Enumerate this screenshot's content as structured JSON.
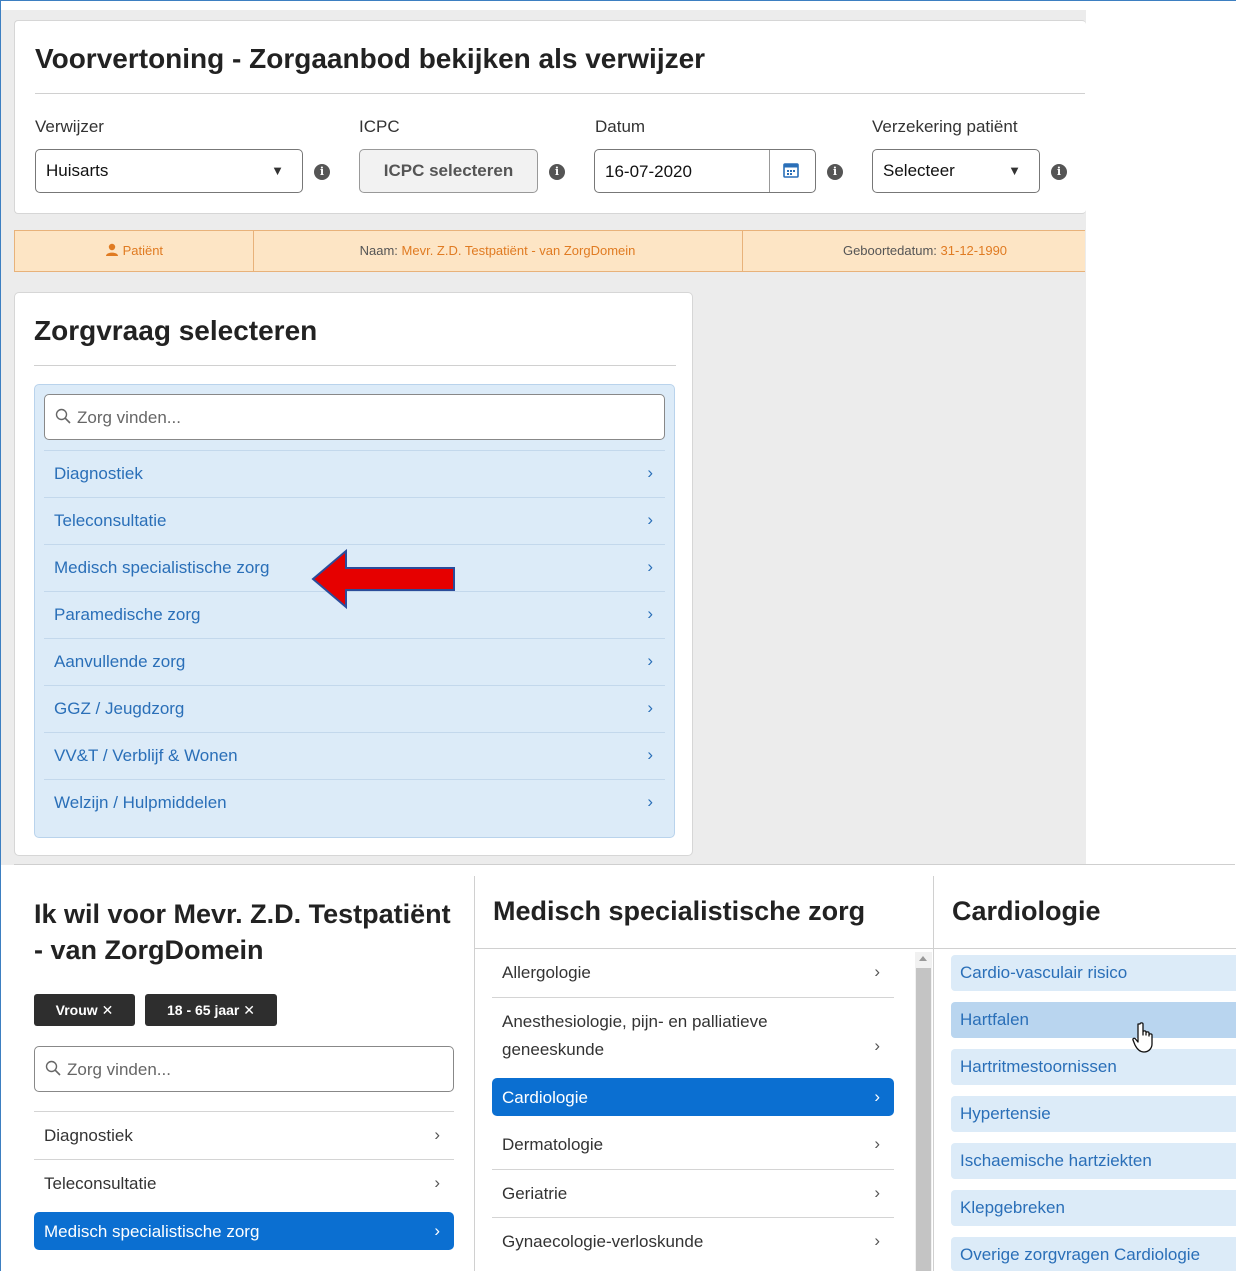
{
  "top": {
    "title": "Voorvertoning - Zorgaanbod bekijken als verwijzer",
    "verwijzer": {
      "label": "Verwijzer",
      "value": "Huisarts"
    },
    "icpc": {
      "label": "ICPC",
      "button": "ICPC selecteren"
    },
    "datum": {
      "label": "Datum",
      "value": "16-07-2020"
    },
    "verzekering": {
      "label": "Verzekering patiënt",
      "value": "Selecteer"
    },
    "info_glyph": "i"
  },
  "patient_bar": {
    "patient_label": "Patiënt",
    "naam_label": "Naam:",
    "naam_value": "Mevr. Z.D. Testpatiënt - van ZorgDomein",
    "geboorte_label": "Geboortedatum:",
    "geboorte_value": "31-12-1990"
  },
  "zorgvraag": {
    "title": "Zorgvraag selecteren",
    "search_placeholder": "Zorg vinden...",
    "items": [
      "Diagnostiek",
      "Teleconsultatie",
      "Medisch specialistische zorg",
      "Paramedische zorg",
      "Aanvullende zorg",
      "GGZ / Jeugdzorg",
      "VV&T / Verblijf & Wonen",
      "Welzijn / Hulpmiddelen"
    ],
    "chevron": "›"
  },
  "bottom": {
    "col1": {
      "title": "Ik wil voor Mevr. Z.D. Testpatiënt - van ZorgDomein",
      "chips": [
        "Vrouw ✕",
        "18 - 65 jaar ✕"
      ],
      "search_placeholder": "Zorg vinden...",
      "items": [
        "Diagnostiek",
        "Teleconsultatie",
        "Medisch specialistische zorg"
      ]
    },
    "col2": {
      "title": "Medisch specialistische zorg",
      "items": [
        "Allergologie",
        "Anesthesiologie, pijn- en palliatieve geneeskunde",
        "Cardiologie",
        "Dermatologie",
        "Geriatrie",
        "Gynaecologie-verloskunde"
      ]
    },
    "col3": {
      "title": "Cardiologie",
      "items": [
        "Cardio-vasculair risico",
        "Hartfalen",
        "Hartritmestoornissen",
        "Hypertensie",
        "Ischaemische hartziekten",
        "Klepgebreken",
        "Overige zorgvragen Cardiologie"
      ]
    }
  },
  "colors": {
    "accent_blue": "#0b6fd1",
    "link_blue": "#2a6fb8",
    "list_bg": "#dcebf8",
    "patient_bar_bg": "#fde5c5",
    "patient_orange": "#e07b22",
    "arrow_red": "#e60000"
  }
}
